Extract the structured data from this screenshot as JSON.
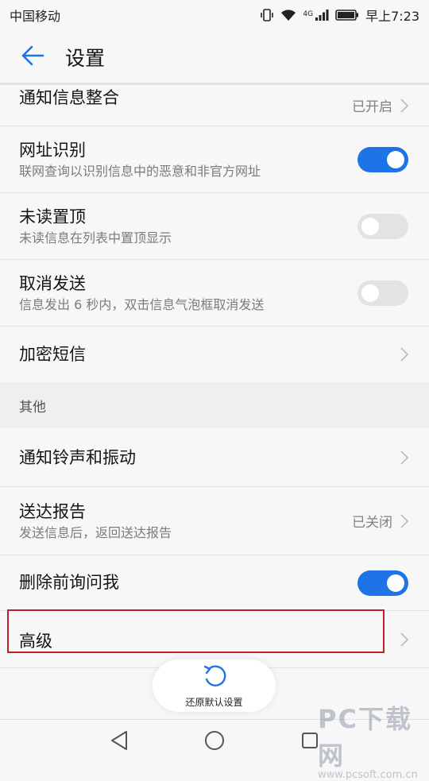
{
  "status_bar": {
    "carrier": "中国移动",
    "network": "4G",
    "time": "早上7:23"
  },
  "app_bar": {
    "title": "设置"
  },
  "rows": {
    "notify_merge": {
      "title": "通知信息整合",
      "value": "已开启"
    },
    "url_detect": {
      "title": "网址识别",
      "subtitle": "联网查询以识别信息中的恶意和非官方网址",
      "toggle": true
    },
    "unread_top": {
      "title": "未读置顶",
      "subtitle": "未读信息在列表中置顶显示",
      "toggle": false
    },
    "cancel_send": {
      "title": "取消发送",
      "subtitle": "信息发出 6 秒内，双击信息气泡框取消发送",
      "toggle": false
    },
    "encrypted_sms": {
      "title": "加密短信"
    }
  },
  "section_other": {
    "label": "其他"
  },
  "rows_other": {
    "ringtone": {
      "title": "通知铃声和振动"
    },
    "delivery_report": {
      "title": "送达报告",
      "subtitle": "发送信息后，返回送达报告",
      "value": "已关闭"
    },
    "confirm_delete": {
      "title": "删除前询问我",
      "toggle": true
    },
    "advanced": {
      "title": "高级"
    }
  },
  "restore_button": {
    "label": "还原默认设置"
  },
  "watermark": {
    "main": "PC下载网",
    "url": "www.pcsoft.com.cn"
  },
  "colors": {
    "accent": "#1e74e6",
    "highlight": "#c0202c"
  }
}
